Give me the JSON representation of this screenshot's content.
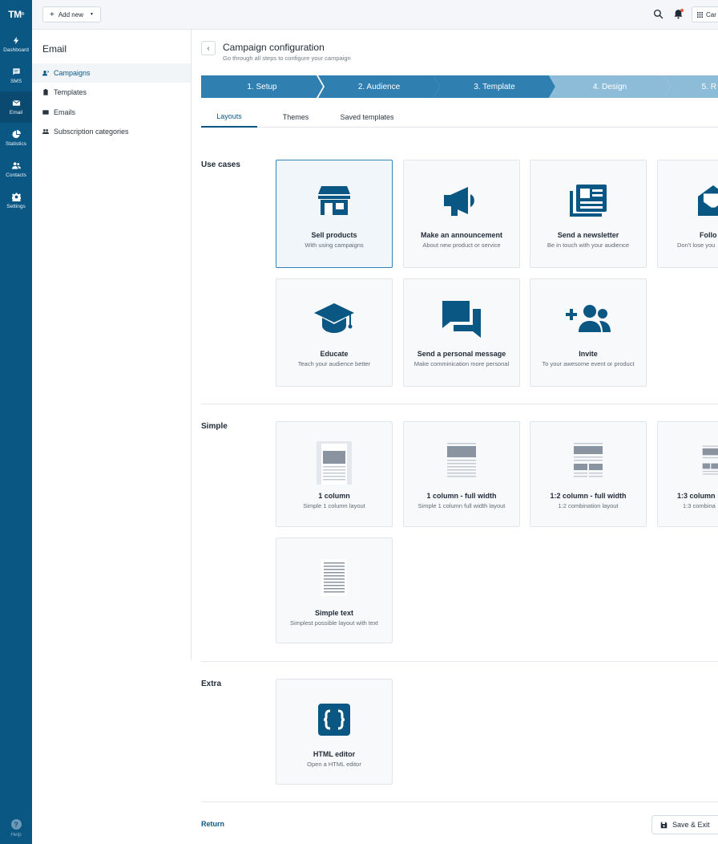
{
  "brand": {
    "logo": "TM",
    "accent": "#0b5784"
  },
  "rail": [
    {
      "label": "Dashboard",
      "icon": "bolt-icon"
    },
    {
      "label": "SMS",
      "icon": "chat-icon"
    },
    {
      "label": "Email",
      "icon": "mail-icon",
      "active": true
    },
    {
      "label": "Statistics",
      "icon": "pie-chart-icon"
    },
    {
      "label": "Contacts",
      "icon": "people-icon"
    },
    {
      "label": "Settings",
      "icon": "gear-icon"
    }
  ],
  "help": "Help",
  "topbar": {
    "add_new": "Add new",
    "apps_label": "Car"
  },
  "subnav": {
    "title": "Email",
    "items": [
      "Campaigns",
      "Templates",
      "Emails",
      "Subscription categories"
    ]
  },
  "page": {
    "title": "Campaign configuration",
    "subtitle": "Go through all steps to configure your campaign"
  },
  "steps": [
    "1. Setup",
    "2. Audience",
    "3. Template",
    "4. Design",
    "5. R"
  ],
  "tabs": [
    "Layouts",
    "Themes",
    "Saved templates"
  ],
  "sections": {
    "use_cases": "Use cases",
    "simple": "Simple",
    "extra": "Extra"
  },
  "use_cases": [
    {
      "name": "Sell products",
      "desc": "With using campaigns",
      "icon": "store-icon"
    },
    {
      "name": "Make an announcement",
      "desc": "About new product or service",
      "icon": "megaphone-icon"
    },
    {
      "name": "Send a newsletter",
      "desc": "Be in touch with your audience",
      "icon": "newsletter-icon"
    },
    {
      "name": "Follo",
      "desc": "Don't lose you",
      "icon": "open-mail-icon"
    },
    {
      "name": "Educate",
      "desc": "Teach your audience better",
      "icon": "graduation-cap-icon"
    },
    {
      "name": "Send a personal message",
      "desc": "Make comminication more personal",
      "icon": "chat-bubbles-icon"
    },
    {
      "name": "Invite",
      "desc": "To your awesome event or product",
      "icon": "add-people-icon"
    }
  ],
  "simple": [
    {
      "name": "1 column",
      "desc": "Simple 1 column layout"
    },
    {
      "name": "1 column - full width",
      "desc": "Simple 1 column full width layout"
    },
    {
      "name": "1:2 column - full width",
      "desc": "1:2 combination layout"
    },
    {
      "name": "1:3 column",
      "desc": "1:3 combina"
    },
    {
      "name": "Simple text",
      "desc": "Simplest possible layout with text"
    }
  ],
  "extra": [
    {
      "name": "HTML editor",
      "desc": "Open a HTML editor",
      "icon": "code-braces-icon"
    }
  ],
  "footer": {
    "return": "Return",
    "save": "Save & Exit"
  }
}
